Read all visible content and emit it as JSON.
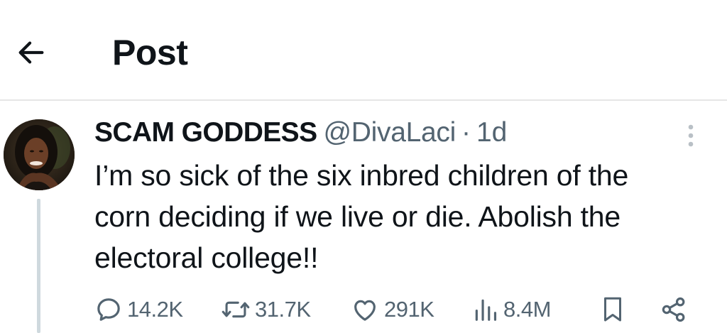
{
  "header": {
    "title": "Post",
    "back_icon": "arrow-left-icon"
  },
  "tweet": {
    "display_name": "SCAM GODDESS",
    "handle": "@DivaLaci",
    "separator": "·",
    "time": "1d",
    "text": "I’m so sick of the six inbred children of the\ncorn deciding if we live or die. Abolish the\nelectoral college!!",
    "avatar_icon": "avatar",
    "more_icon": "more-vertical-icon"
  },
  "actions": {
    "replies": "14.2K",
    "reposts": "31.7K",
    "likes": "291K",
    "views": "8.4M",
    "icons": [
      "reply-icon",
      "repost-icon",
      "like-icon",
      "views-icon",
      "bookmark-icon",
      "share-icon"
    ]
  },
  "colors": {
    "text": "#0f1419",
    "secondary": "#536471",
    "divider": "#e6e6e6",
    "thread_line": "#cfd9de"
  }
}
